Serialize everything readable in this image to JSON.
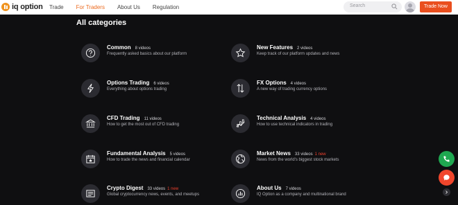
{
  "brand": {
    "logo_text": "iq option"
  },
  "nav": {
    "items": [
      "Trade",
      "For Traders",
      "About Us",
      "Regulation"
    ],
    "active": "For Traders"
  },
  "search": {
    "placeholder": "Search"
  },
  "header": {
    "trade_now": "Trade Now"
  },
  "page": {
    "heading": "All categories"
  },
  "categories": [
    {
      "title": "Common",
      "count": "8 videos",
      "new": "",
      "desc": "Frequently asked basics about our platform",
      "icon": "question-icon"
    },
    {
      "title": "New Features",
      "count": "2 videos",
      "new": "",
      "desc": "Keep track of our platform updates and news",
      "icon": "star-icon"
    },
    {
      "title": "Options Trading",
      "count": "6 videos",
      "new": "",
      "desc": "Everything about options trading",
      "icon": "lightning-icon"
    },
    {
      "title": "FX Options",
      "count": "4 videos",
      "new": "",
      "desc": "A new way of trading currency options",
      "icon": "exchange-arrows-icon"
    },
    {
      "title": "CFD Trading",
      "count": "11 videos",
      "new": "",
      "desc": "How to get the most out of CFD trading",
      "icon": "bank-icon"
    },
    {
      "title": "Technical Analysis",
      "count": "4 videos",
      "new": "",
      "desc": "How to use technical indicators in trading",
      "icon": "indicator-chart-icon"
    },
    {
      "title": "Fundamental Analysis",
      "count": "5 videos",
      "new": "",
      "desc": "How to trade the news and financial calendar",
      "icon": "calendar-icon"
    },
    {
      "title": "Market News",
      "count": "33 videos",
      "new": "1 new",
      "desc": "News from the world's biggest stock markets",
      "icon": "globe-icon"
    },
    {
      "title": "Crypto Digest",
      "count": "33 videos",
      "new": "1 new",
      "desc": "Global cryptocurrency news, events, and meetups",
      "icon": "newspaper-icon"
    },
    {
      "title": "About Us",
      "count": "7 videos",
      "new": "",
      "desc": "IQ Option as a company and multinational brand",
      "icon": "bar-chart-icon"
    }
  ],
  "colors": {
    "accent": "#ea4f1e",
    "nav_active": "#ec6a1e",
    "background": "#0f0f11",
    "new_badge": "#f1422e",
    "call": "#1fa750",
    "chat": "#f0462c"
  }
}
